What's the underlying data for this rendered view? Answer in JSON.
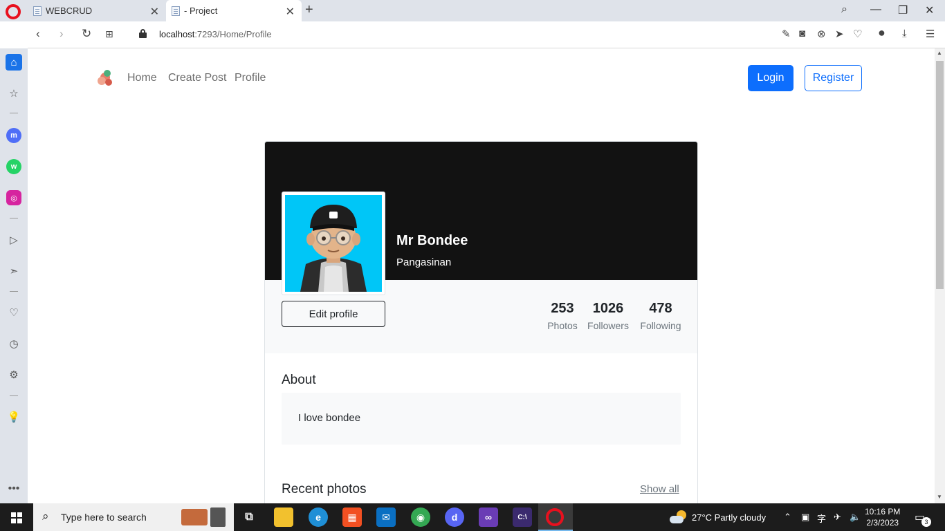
{
  "browser": {
    "tabs": [
      {
        "title": "WEBCRUD"
      },
      {
        "title": "- Project"
      }
    ],
    "url_host": "localhost",
    "url_rest": ":7293/Home/Profile"
  },
  "site": {
    "nav": [
      "Home",
      "Create Post",
      "Profile"
    ],
    "login_label": "Login",
    "register_label": "Register"
  },
  "profile": {
    "name": "Mr Bondee",
    "location": "Pangasinan",
    "edit_label": "Edit profile",
    "stats": [
      {
        "value": "253",
        "label": "Photos"
      },
      {
        "value": "1026",
        "label": "Followers"
      },
      {
        "value": "478",
        "label": "Following"
      }
    ],
    "about_heading": "About",
    "about_text": "I love bondee",
    "recent_heading": "Recent photos",
    "show_all_label": "Show all"
  },
  "taskbar": {
    "search_placeholder": "Type here to search",
    "weather": "27°C  Partly cloudy",
    "time": "10:16 PM",
    "date": "2/3/2023",
    "notification_count": "3"
  },
  "colors": {
    "primary": "#0d6efd",
    "cover": "#121212",
    "avatar_bg": "#00c6f7"
  }
}
